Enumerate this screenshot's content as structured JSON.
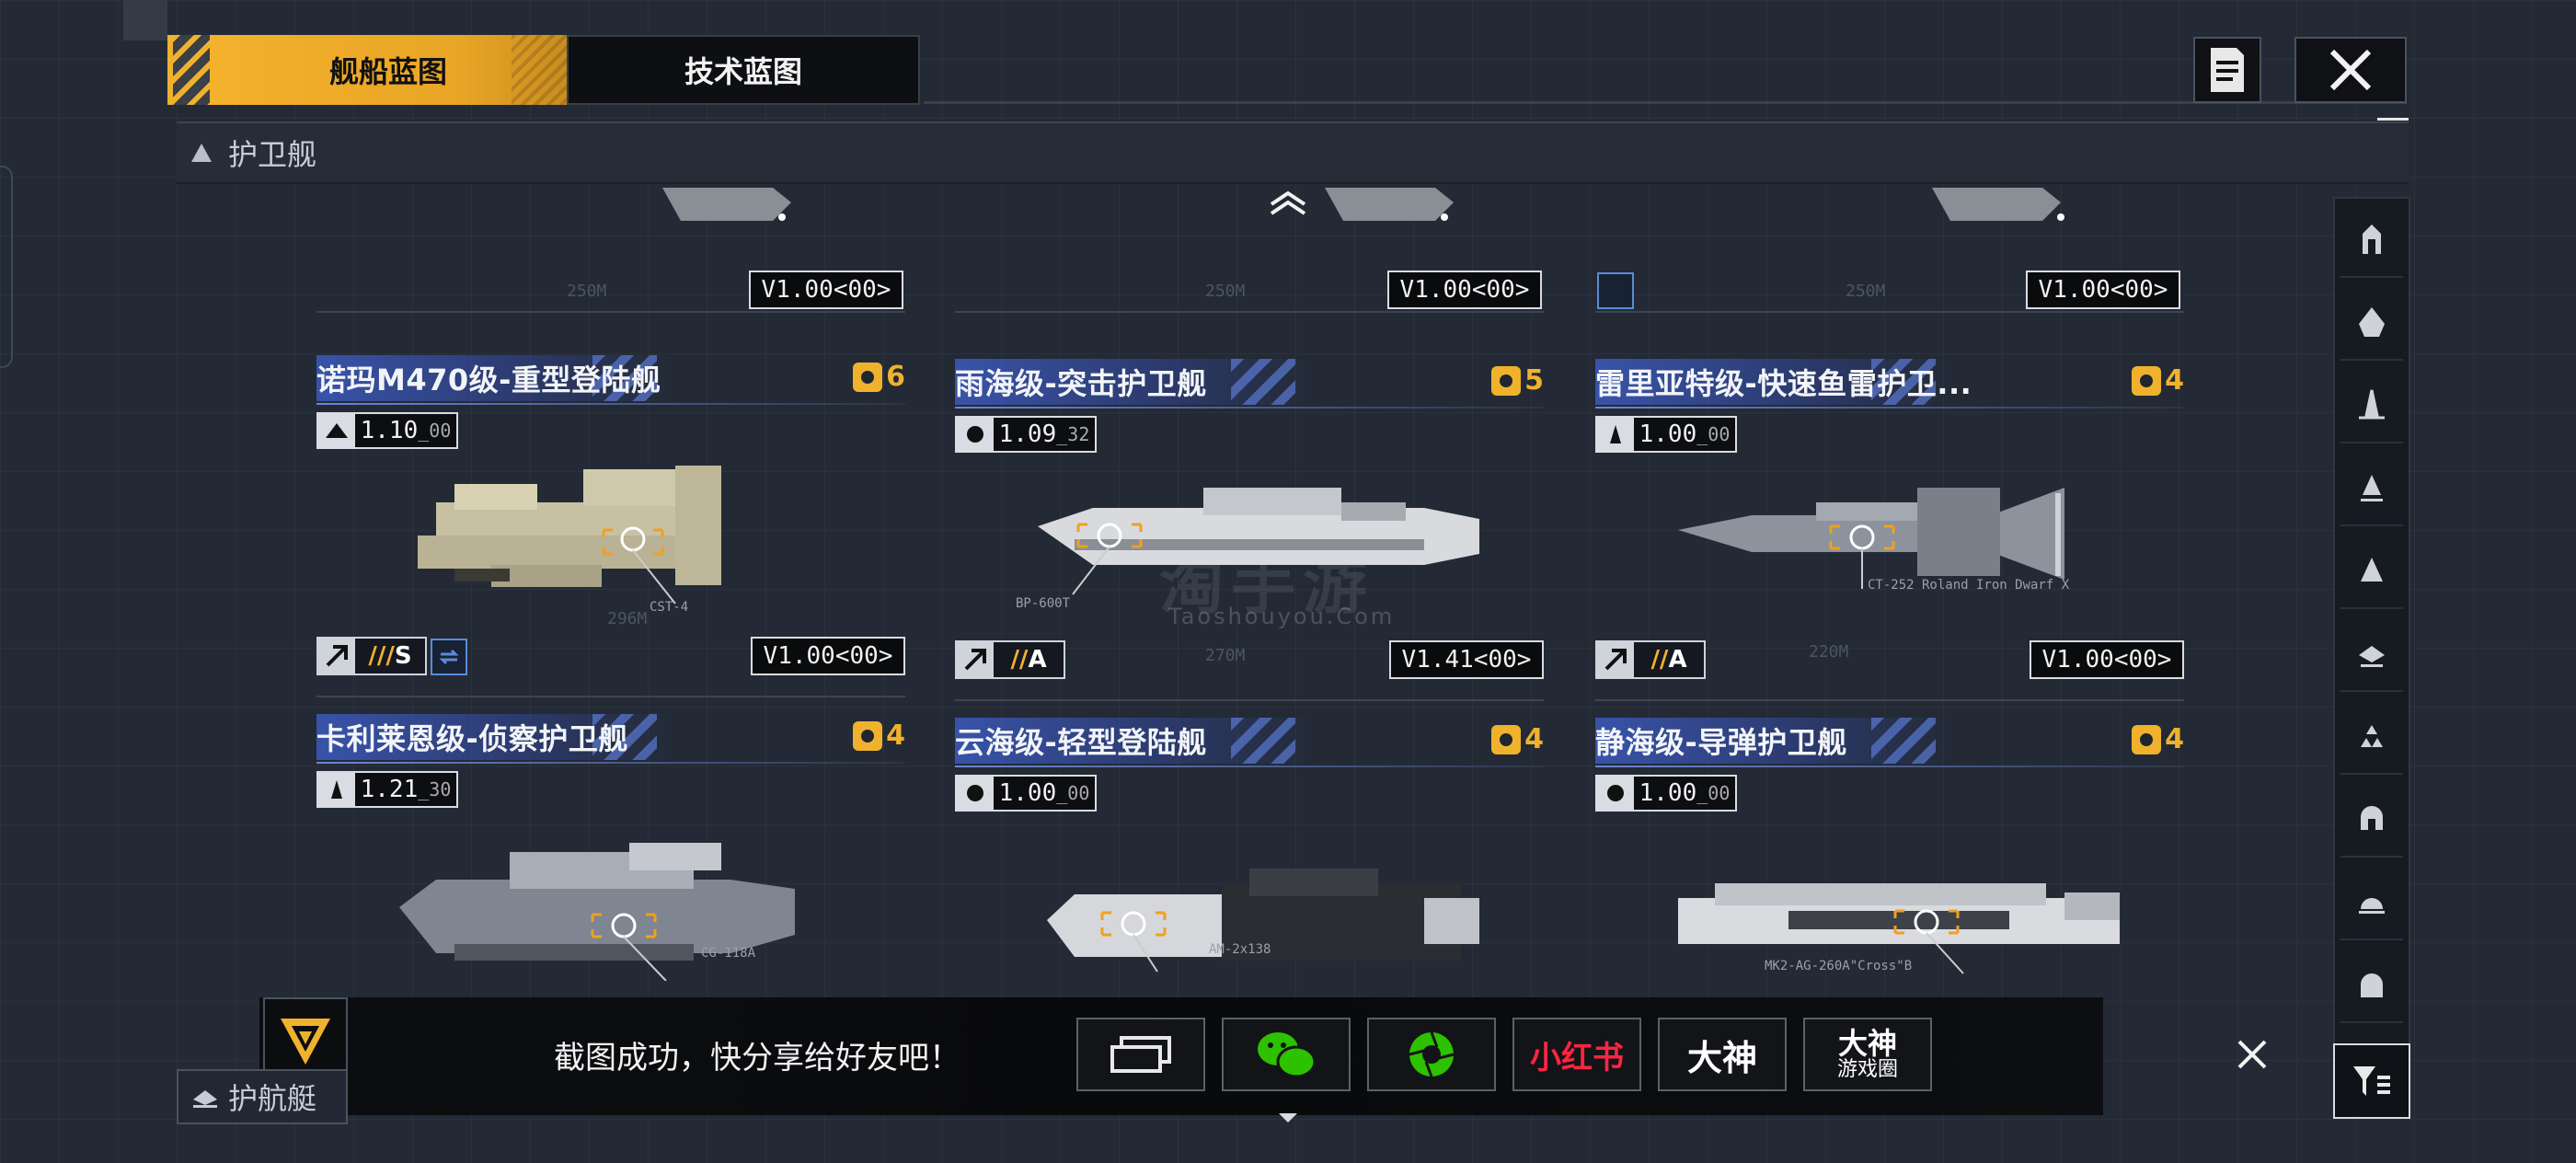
{
  "tabs": {
    "active_label": "舰船蓝图",
    "inactive_label": "技术蓝图"
  },
  "section": {
    "current": "护卫舰",
    "next": "护航艇"
  },
  "previous_row_versions": [
    "V1.00<00>",
    "V1.00<00>",
    "V1.00<00>"
  ],
  "previous_row_dims": [
    "250M",
    "250M",
    "250M"
  ],
  "ships": [
    {
      "name": "诺玛M470级-重型登陆舰",
      "cost": "6",
      "version": "1.10",
      "sub": "00",
      "grade": "S",
      "grade_prefix": "///",
      "blueprint": "V1.00<00>",
      "length": "296M",
      "weapon": "CST-4",
      "has_swap": true
    },
    {
      "name": "雨海级-突击护卫舰",
      "cost": "5",
      "version": "1.09",
      "sub": "32",
      "grade": "A",
      "grade_prefix": "//",
      "blueprint": "V1.41<00>",
      "length": "270M",
      "weapon": "BP-600T",
      "has_swap": false
    },
    {
      "name": "雷里亚特级-快速鱼雷护卫...",
      "cost": "4",
      "version": "1.00",
      "sub": "00",
      "grade": "A",
      "grade_prefix": "//",
      "blueprint": "V1.00<00>",
      "length": "220M",
      "weapon": "CT-252 Roland Iron Dwarf X",
      "has_swap": false
    },
    {
      "name": "卡利莱恩级-侦察护卫舰",
      "cost": "4",
      "version": "1.21",
      "sub": "30",
      "weapon": "CG-118A"
    },
    {
      "name": "云海级-轻型登陆舰",
      "cost": "4",
      "version": "1.00",
      "sub": "00",
      "weapon": "AM-2x138"
    },
    {
      "name": "静海级-导弹护卫舰",
      "cost": "4",
      "version": "1.00",
      "sub": "00",
      "weapon": "MK2-AG-260A\"Cross\"B"
    }
  ],
  "share": {
    "message": "截图成功，快分享给好友吧！",
    "xiaohongshu": "小红书",
    "dashen": "大神",
    "dashen_circle_top": "大神",
    "dashen_circle_bottom": "游戏圈"
  },
  "watermark": {
    "main": "淘手游",
    "sub": "Taoshouyou.Com"
  },
  "colors": {
    "accent_yellow": "#f0b22d",
    "title_blue": "#3c5abe",
    "background": "#232a35"
  }
}
